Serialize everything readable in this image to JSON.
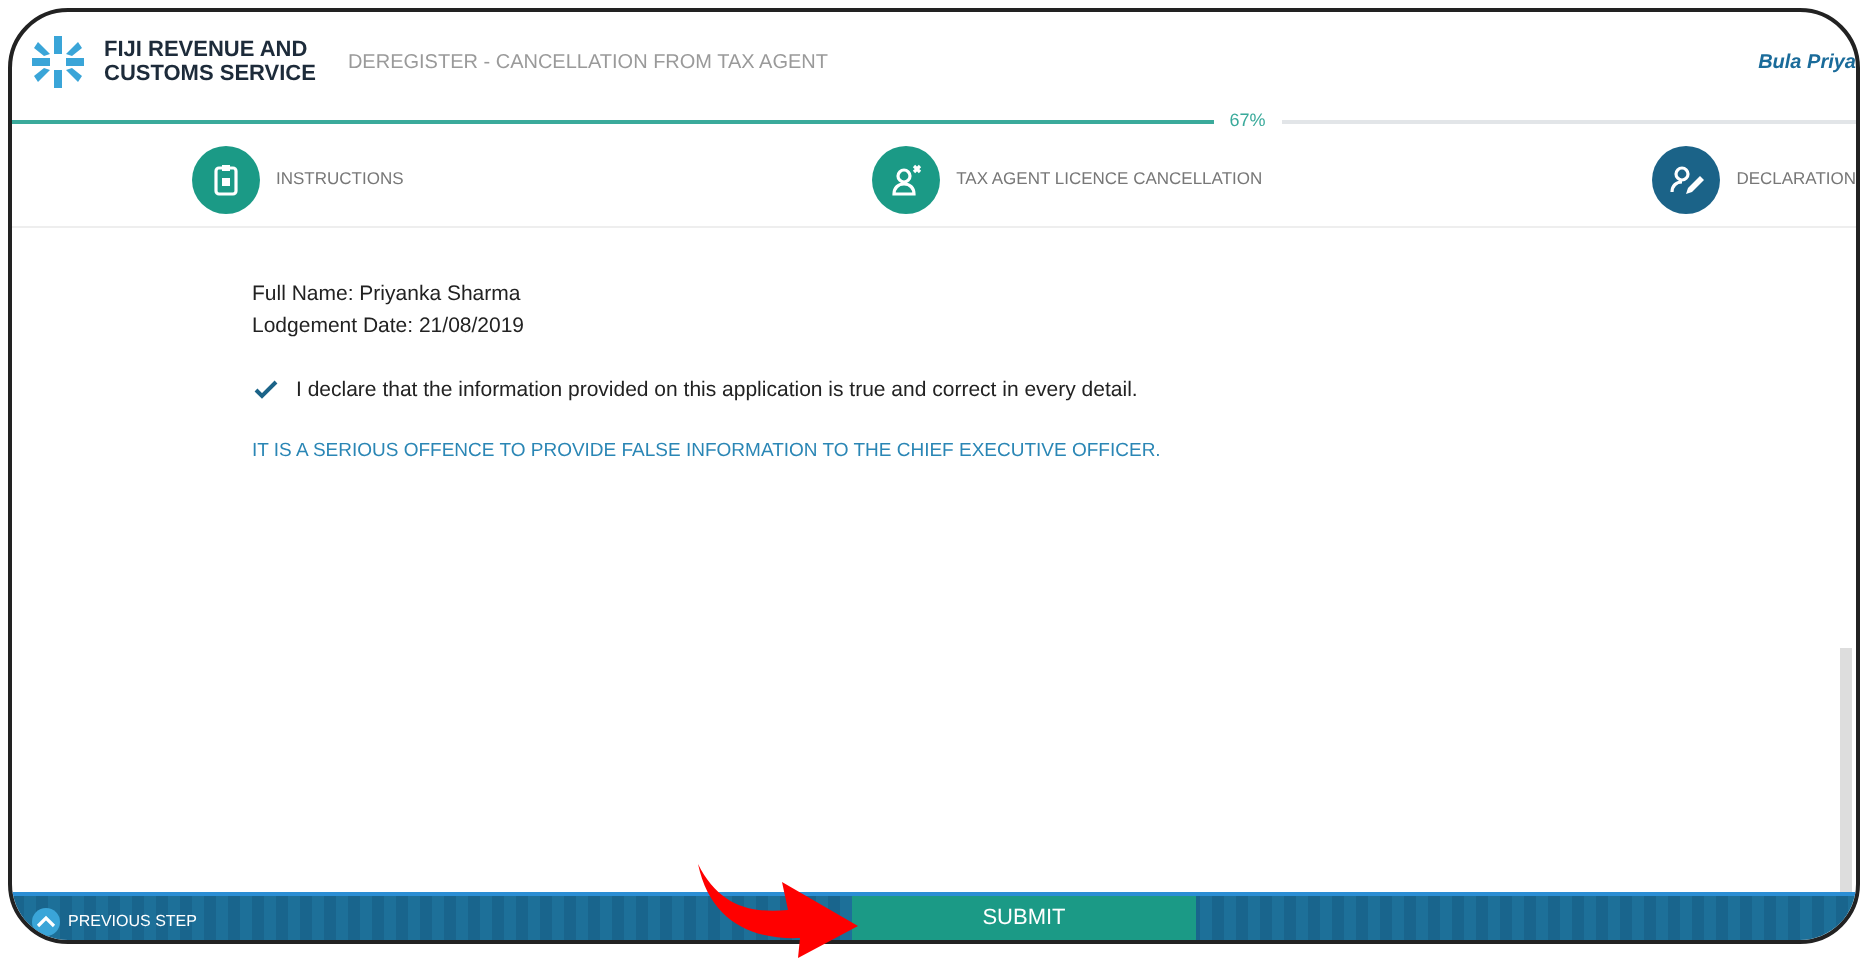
{
  "header": {
    "brand": [
      "FIJI REVENUE AND",
      "CUSTOMS SERVICE"
    ],
    "page_title": "DEREGISTER - CANCELLATION FROM TAX AGENT",
    "greeting": "Bula Priya"
  },
  "progress": {
    "level": 0.67,
    "reading": "67%"
  },
  "steps": [
    {
      "label": "INSTRUCTIONS",
      "kind": "clipboard",
      "selected": false
    },
    {
      "label": "TAX AGENT LICENCE CANCELLATION",
      "kind": "user-remove",
      "selected": false
    },
    {
      "label": "DECLARATION",
      "kind": "user-edit",
      "selected": true
    }
  ],
  "details": [
    "Full Name: Priyanka Sharma",
    "Lodgement Date: 21/08/2019"
  ],
  "declaration": {
    "text": "I declare that the information provided on this application is true and correct in every detail.",
    "checked": true
  },
  "warning": "IT IS A SERIOUS OFFENCE TO PROVIDE FALSE INFORMATION TO THE CHIEF EXECUTIVE OFFICER.",
  "footer": {
    "previous": "PREVIOUS STEP",
    "submit": "SUBMIT"
  }
}
